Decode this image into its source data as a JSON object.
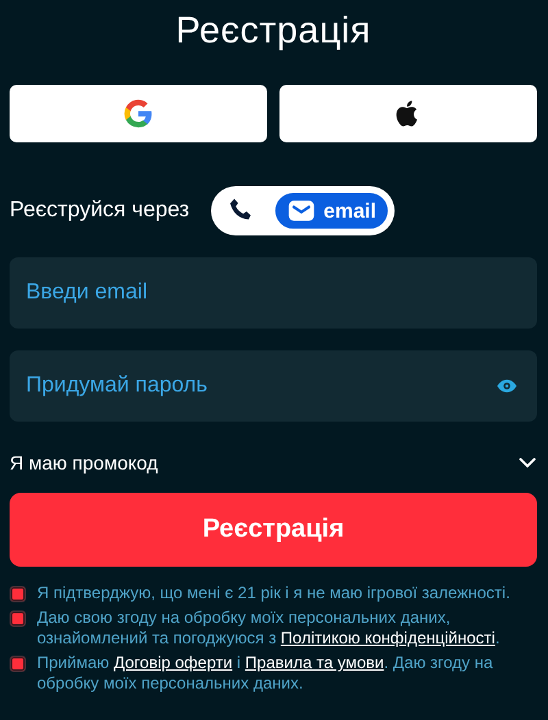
{
  "title": "Реєстрація",
  "social_buttons": [
    {
      "kind": "google"
    },
    {
      "kind": "apple"
    }
  ],
  "register_via": {
    "label": "Реєструйся через",
    "options": [
      {
        "kind": "phone",
        "selected": false
      },
      {
        "kind": "email",
        "label": "email",
        "selected": true
      }
    ]
  },
  "fields": [
    {
      "placeholder": "Введи email",
      "kind": "email"
    },
    {
      "placeholder": "Придумай пароль",
      "kind": "password"
    }
  ],
  "promo": {
    "label": "Я маю промокод",
    "expanded": false
  },
  "submit": "Реєстрація",
  "consents": [
    {
      "checked": true,
      "parts": [
        {
          "text": "Я підтверджую, що мені є 21 рік і я не маю ігрової залежності."
        }
      ]
    },
    {
      "checked": true,
      "parts": [
        {
          "text": "Даю свою згоду на обробку моїх персональних даних, ознайомлений та погоджуюся з "
        },
        {
          "text": "Політикою конфіденційності",
          "link": true
        },
        {
          "text": "."
        }
      ]
    },
    {
      "checked": true,
      "parts": [
        {
          "text": "Приймаю "
        },
        {
          "text": "Договір оферти",
          "link": true
        },
        {
          "text": " і "
        },
        {
          "text": "Правила та умови",
          "link": true
        },
        {
          "text": ". Даю згоду на обробку моїх персональних даних."
        }
      ]
    }
  ]
}
